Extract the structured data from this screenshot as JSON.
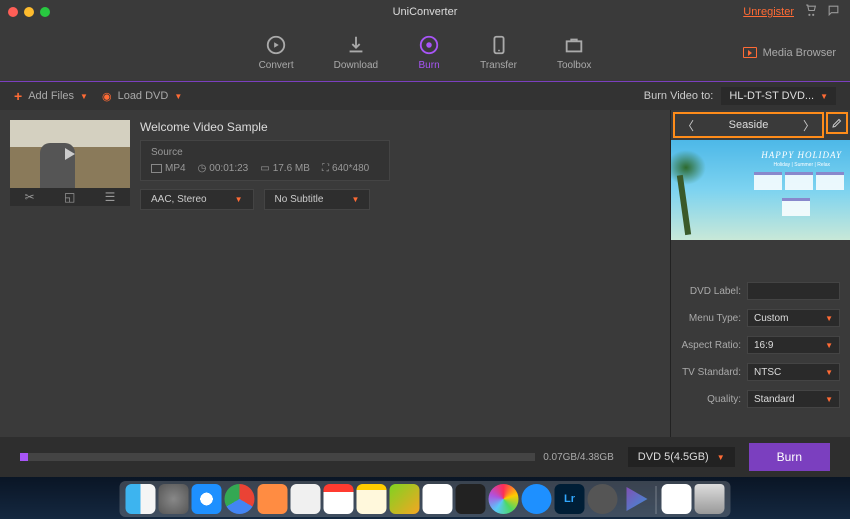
{
  "titlebar": {
    "title": "UniConverter",
    "unregister": "Unregister"
  },
  "tabs": {
    "convert": "Convert",
    "download": "Download",
    "burn": "Burn",
    "transfer": "Transfer",
    "toolbox": "Toolbox",
    "media_browser": "Media Browser"
  },
  "actionbar": {
    "add_files": "Add Files",
    "load_dvd": "Load DVD",
    "burn_to_label": "Burn Video to:",
    "drive": "HL-DT-ST DVD..."
  },
  "video": {
    "title": "Welcome Video Sample",
    "source_label": "Source",
    "format": "MP4",
    "duration": "00:01:23",
    "size": "17.6 MB",
    "resolution": "640*480",
    "audio_select": "AAC, Stereo",
    "subtitle_select": "No Subtitle"
  },
  "template": {
    "name": "Seaside",
    "banner_title": "HAPPY HOLIDAY",
    "banner_sub": "Holiday | Summer | Relax"
  },
  "settings": {
    "dvd_label_label": "DVD Label:",
    "dvd_label_value": "",
    "menu_type_label": "Menu Type:",
    "menu_type_value": "Custom",
    "aspect_label": "Aspect Ratio:",
    "aspect_value": "16:9",
    "tv_label": "TV Standard:",
    "tv_value": "NTSC",
    "quality_label": "Quality:",
    "quality_value": "Standard"
  },
  "bottom": {
    "progress_text": "0.07GB/4.38GB",
    "disc": "DVD 5(4.5GB)",
    "burn": "Burn"
  }
}
